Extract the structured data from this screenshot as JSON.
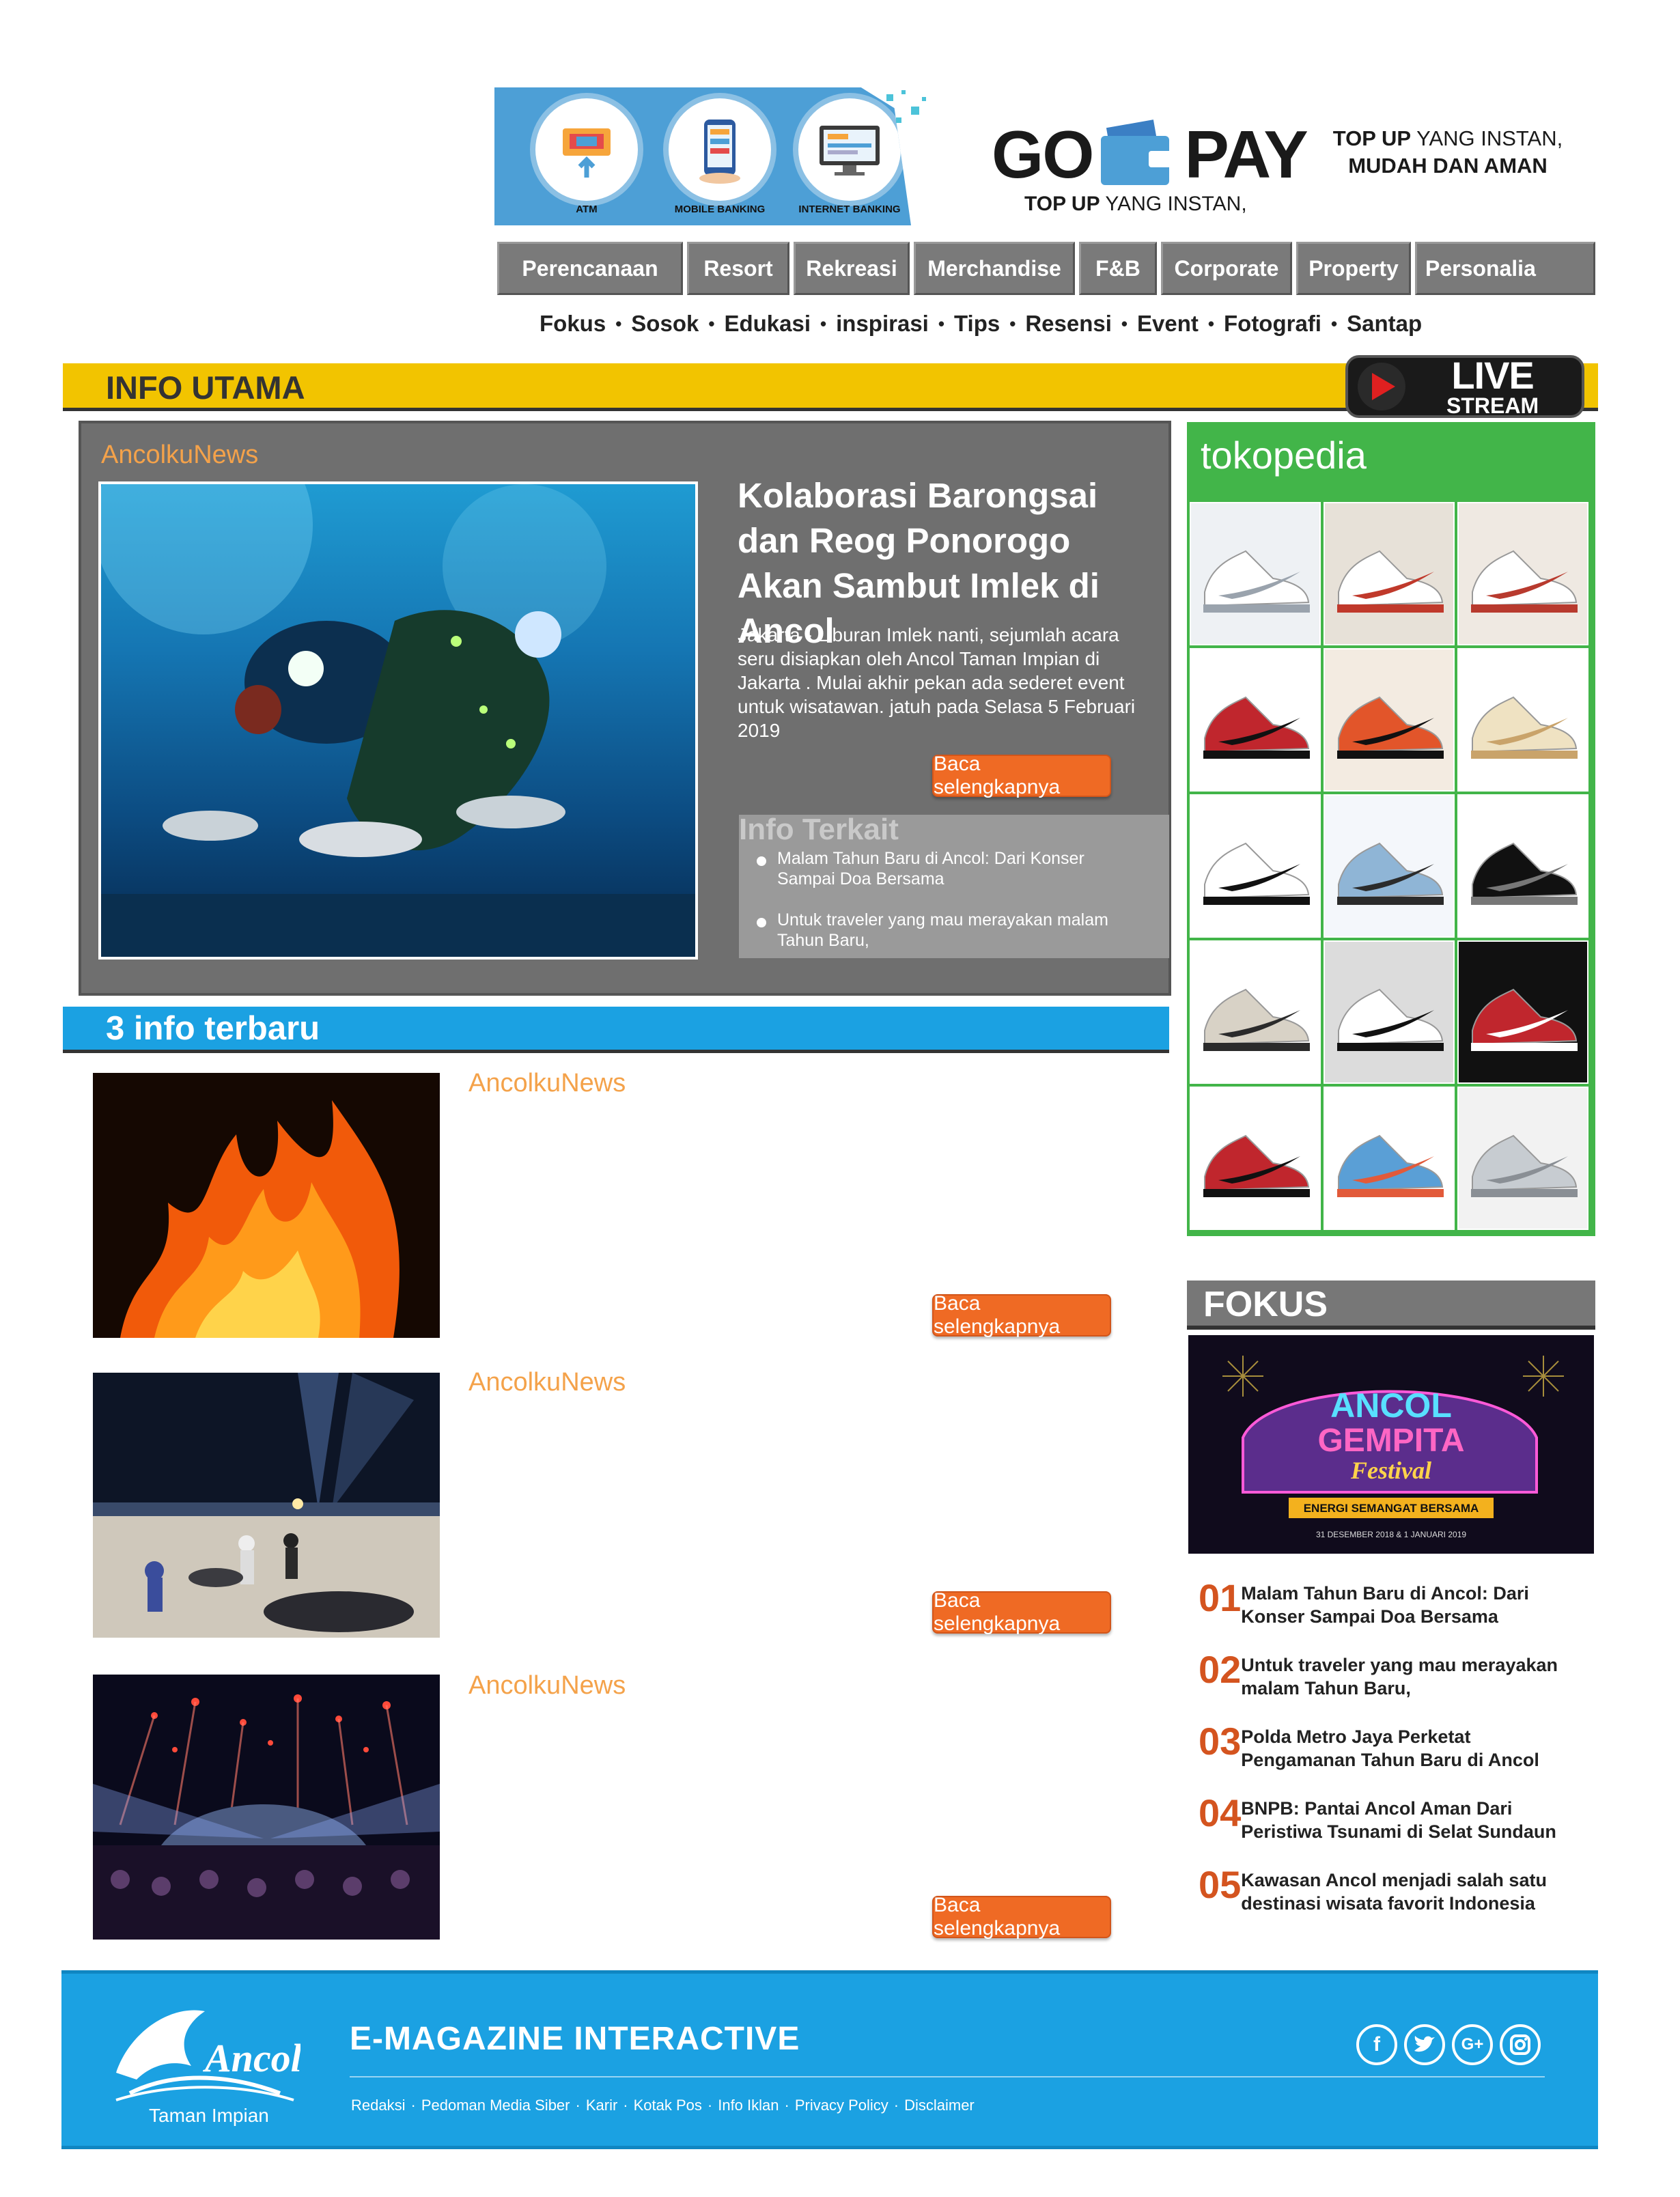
{
  "banner": {
    "banks": [
      "ATM",
      "MOBILE BANKING",
      "INTERNET BANKING"
    ],
    "gopay_left": "GO",
    "gopay_right": "PAY",
    "gopay_sub_bold": "TOP UP",
    "gopay_sub_rest": " YANG INSTAN,",
    "right_line1_bold": "TOP UP",
    "right_line1_rest": " YANG INSTAN,",
    "right_line2": "MUDAH DAN AMAN",
    "brand_color": "#4d9fd6"
  },
  "nav": {
    "items": [
      "Perencanaan",
      "Resort",
      "Rekreasi",
      "Merchandise",
      "F&B",
      "Corporate",
      "Property",
      "Personalia"
    ]
  },
  "subnav": {
    "items": [
      "Fokus",
      "Sosok",
      "Edukasi",
      "inspirasi",
      "Tips",
      "Resensi",
      "Event",
      "Fotografi",
      "Santap"
    ],
    "separator": "•"
  },
  "info_utama": {
    "title": "INFO UTAMA",
    "live_big": "LIVE",
    "live_small": "STREAM",
    "bar_color": "#f2c400"
  },
  "featured": {
    "source": "AncolkuNews",
    "title": "Kolaborasi Barongsai dan Reog Ponorogo Akan Sambut Imlek di Ancol",
    "description": "Jakarta - Liburan Imlek nanti, sejumlah acara seru disiapkan oleh Ancol Taman Impian di Jakarta . Mulai akhir pekan ada sederet event untuk wisatawan. jatuh pada Selasa 5 Februari 2019",
    "read_more": "Baca selengkapnya",
    "related_title": "Info Terkait",
    "related": [
      "Malam Tahun Baru di Ancol: Dari Konser Sampai Doa Bersama",
      "Untuk traveler yang mau merayakan malam Tahun Baru,"
    ]
  },
  "tokopedia": {
    "logo": "tokopedia",
    "color": "#42b549"
  },
  "terbaru": {
    "title": "3 info terbaru",
    "items": [
      {
        "source": "AncolkuNews",
        "read_more": "Baca selengkapnya"
      },
      {
        "source": "AncolkuNews",
        "read_more": "Baca selengkapnya"
      },
      {
        "source": "AncolkuNews",
        "read_more": "Baca selengkapnya"
      }
    ]
  },
  "fokus": {
    "title": "FOKUS",
    "image_text": {
      "line1": "ANCOL",
      "line2": "GEMPITA",
      "line3": "Festival",
      "tagline": "ENERGI SEMANGAT BERSAMA",
      "dates": "31 DESEMBER 2018 & 1 JANUARI 2019"
    },
    "items": [
      {
        "num": "01",
        "text": "Malam Tahun Baru di Ancol: Dari Konser Sampai Doa Bersama"
      },
      {
        "num": "02",
        "text": "Untuk traveler yang mau merayakan malam Tahun Baru,"
      },
      {
        "num": "03",
        "text": "Polda Metro Jaya Perketat Pengamanan Tahun Baru di Ancol"
      },
      {
        "num": "04",
        "text": "BNPB: Pantai Ancol Aman Dari Peristiwa Tsunami di Selat Sundaun"
      },
      {
        "num": "05",
        "text": "Kawasan Ancol menjadi salah satu destinasi wisata favorit Indonesia"
      }
    ]
  },
  "footer": {
    "title": "E-MAGAZINE INTERACTIVE",
    "logo_text": "Ancol",
    "logo_sub": "Taman Impian",
    "links": [
      "Redaksi",
      "Pedoman Media Siber",
      "Karir",
      "Kotak Pos",
      "Info Iklan",
      "Privacy Policy",
      "Disclaimer"
    ],
    "link_separator": "·",
    "social": [
      "facebook-icon",
      "twitter-icon",
      "google-plus-icon",
      "instagram-icon"
    ],
    "color": "#1ba1e2"
  }
}
